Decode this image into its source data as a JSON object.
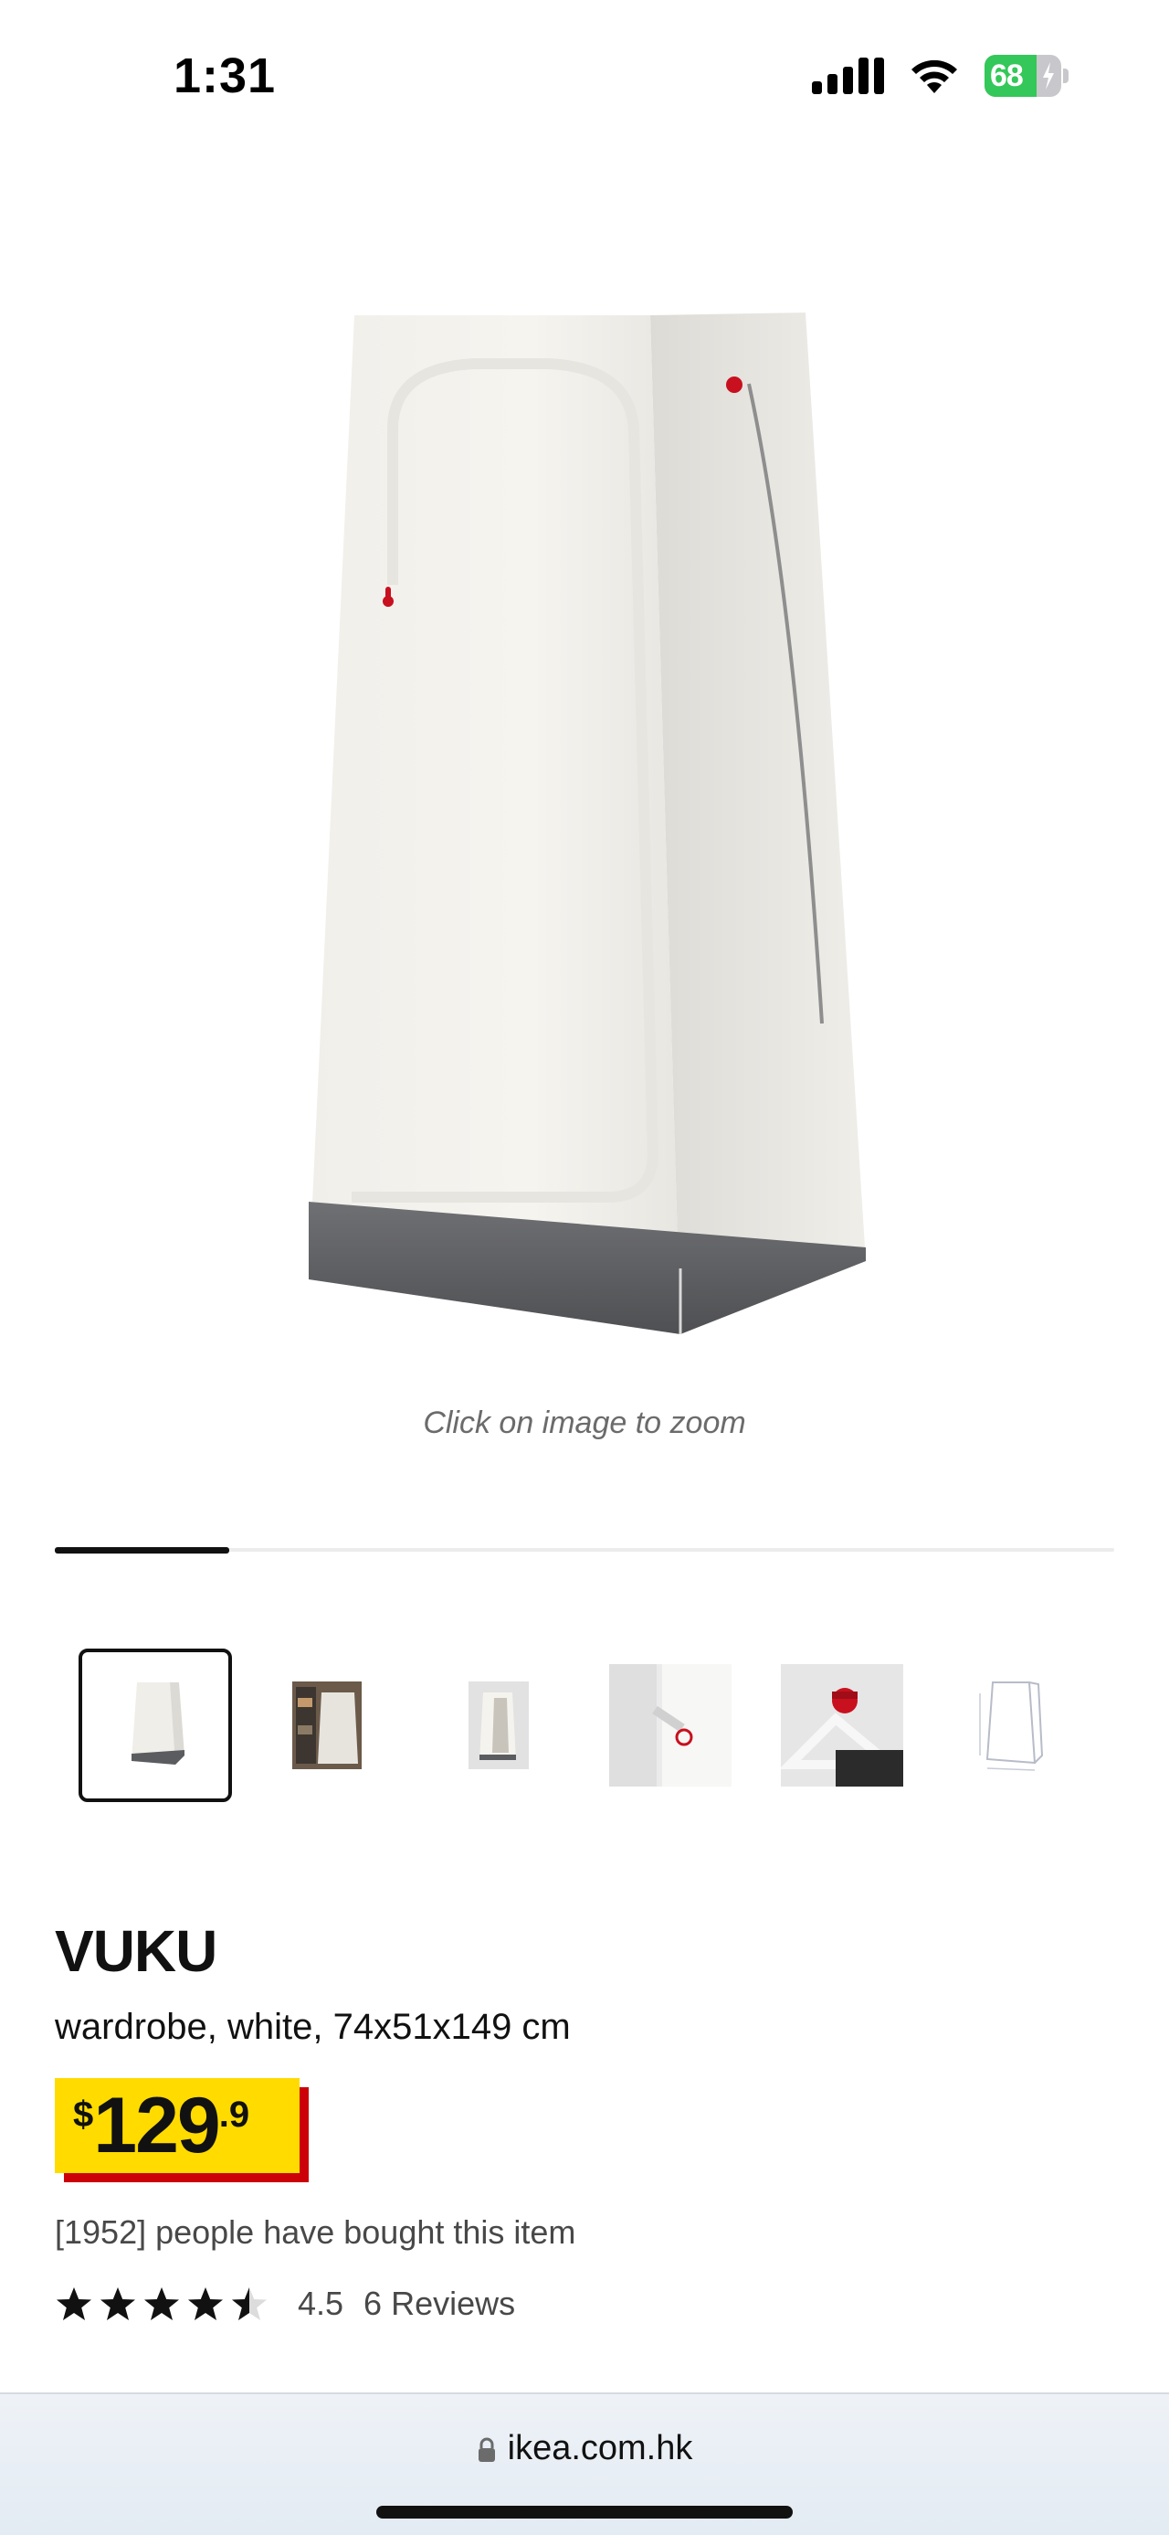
{
  "status_bar": {
    "time": "1:31",
    "battery_percent": "68",
    "icons": [
      "cellular-signal-icon",
      "wifi-icon",
      "battery-charging-icon"
    ]
  },
  "product_image": {
    "zoom_hint": "Click on image to zoom"
  },
  "carousel": {
    "progress": 0.165,
    "thumbnail_count": 6,
    "active_thumbnail": 0
  },
  "product": {
    "name": "VUKU",
    "description": "wardrobe, white, 74x51x149 cm",
    "price": {
      "currency": "$",
      "integer": "129",
      "decimal": ".9",
      "tag_color": "#ffdb00",
      "shadow_color": "#cc0008"
    },
    "bought_text": "[1952] people have bought this item",
    "rating": {
      "value": "4.5",
      "stars": 4.5,
      "reviews_label": "6 Reviews"
    }
  },
  "browser": {
    "url": "ikea.com.hk"
  }
}
